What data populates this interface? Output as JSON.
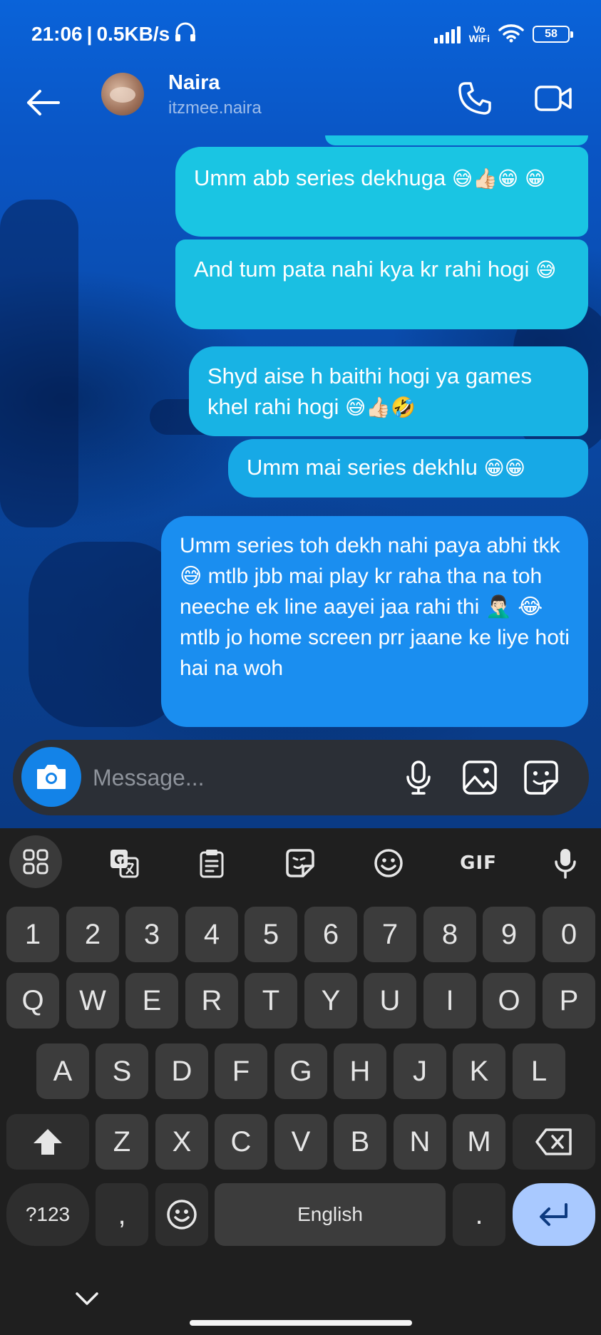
{
  "status_bar": {
    "time": "21:06",
    "separator": "|",
    "net_speed": "0.5KB/s",
    "vowifi_line1": "Vo",
    "vowifi_line2": "WiFi",
    "battery": "58"
  },
  "header": {
    "contact_name": "Naira",
    "contact_handle": "itzmee.naira"
  },
  "messages": [
    {
      "text": "Umm abb series dekhuga",
      "emoji": "😅👍🏻😁 😁"
    },
    {
      "text": "And tum pata nahi kya kr rahi hogi",
      "emoji": "😅"
    },
    {
      "text": "Shyd aise h baithi hogi ya games khel rahi hogi",
      "emoji": "😅👍🏻🤣"
    },
    {
      "text": "Umm mai series dekhlu",
      "emoji": "😁😁"
    },
    {
      "text": "Umm series toh dekh nahi paya abhi tkk 😅 mtlb jbb mai play kr raha tha na toh neeche ek line aayei jaa rahi thi 🤦🏻‍♂️ 😂 mtlb jo home screen prr jaane ke liye hoti hai na woh"
    }
  ],
  "composer": {
    "placeholder": "Message..."
  },
  "keyboard": {
    "toolbar_gif": "GIF",
    "row_numbers": [
      "1",
      "2",
      "3",
      "4",
      "5",
      "6",
      "7",
      "8",
      "9",
      "0"
    ],
    "row_1": [
      "Q",
      "W",
      "E",
      "R",
      "T",
      "Y",
      "U",
      "I",
      "O",
      "P"
    ],
    "row_2": [
      "A",
      "S",
      "D",
      "F",
      "G",
      "H",
      "J",
      "K",
      "L"
    ],
    "row_3": [
      "Z",
      "X",
      "C",
      "V",
      "B",
      "N",
      "M"
    ],
    "symbols_key": "?123",
    "comma_key": ",",
    "space_label": "English",
    "period_key": "."
  },
  "colors": {
    "chat_bg_top": "#0a63d9",
    "bubble_cyan": "#1ac5e3",
    "bubble_blue": "#1a8ef0",
    "composer_bg": "#2b2f36",
    "camera_button": "#1383e8",
    "keyboard_bg": "#1f1f1f",
    "enter_key": "#a9c9ff"
  }
}
